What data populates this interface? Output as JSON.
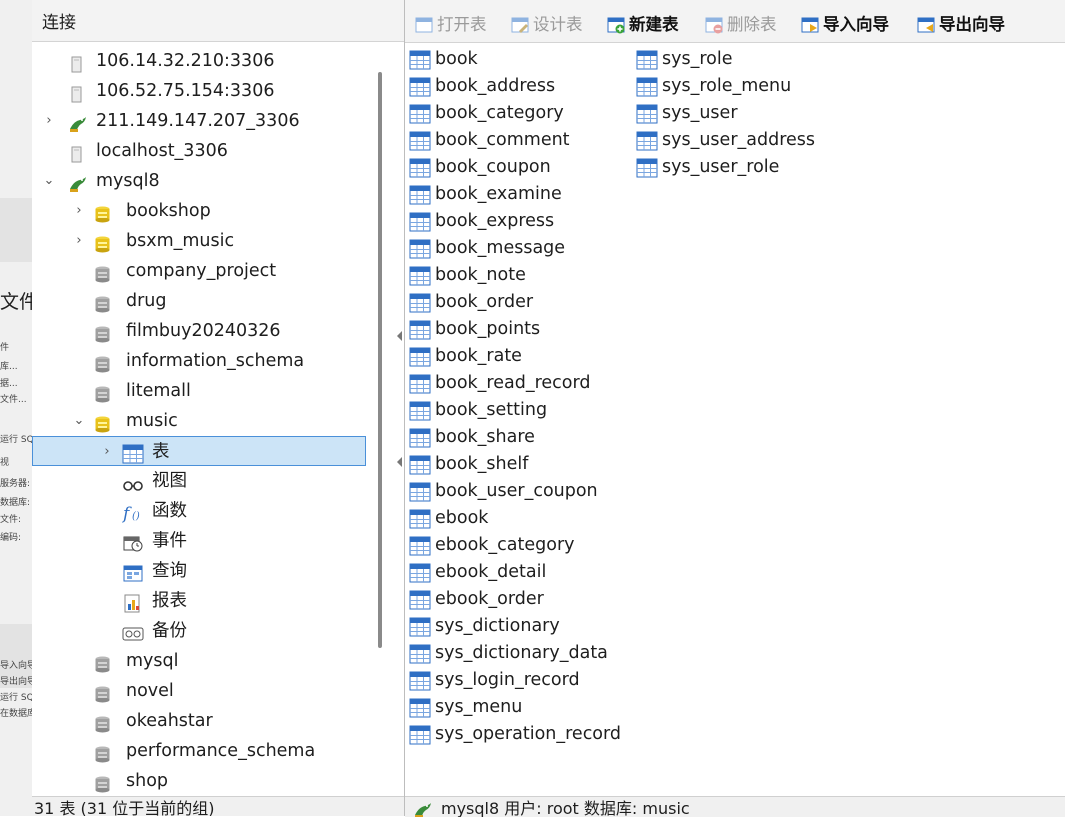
{
  "connections_panel": {
    "title": "连接",
    "status": "31 表 (31 位于当前的组)"
  },
  "tree": [
    {
      "label": "106.14.32.210:3306",
      "icon": "server-file-icon",
      "chevron": "",
      "level": 0
    },
    {
      "label": "106.52.75.154:3306",
      "icon": "server-file-icon",
      "chevron": "",
      "level": 0
    },
    {
      "label": "211.149.147.207_3306",
      "icon": "connection-dolphin-icon",
      "chevron": "›",
      "level": 0
    },
    {
      "label": "localhost_3306",
      "icon": "server-file-icon",
      "chevron": "",
      "level": 0
    },
    {
      "label": "mysql8",
      "icon": "connection-dolphin-icon",
      "chevron": "⌄",
      "level": 0
    },
    {
      "label": "bookshop",
      "icon": "database-open-icon",
      "chevron": "›",
      "level": 1
    },
    {
      "label": "bsxm_music",
      "icon": "database-open-icon",
      "chevron": "›",
      "level": 1
    },
    {
      "label": "company_project",
      "icon": "database-closed-icon",
      "chevron": "",
      "level": 1
    },
    {
      "label": "drug",
      "icon": "database-closed-icon",
      "chevron": "",
      "level": 1
    },
    {
      "label": "filmbuy20240326",
      "icon": "database-closed-icon",
      "chevron": "",
      "level": 1
    },
    {
      "label": "information_schema",
      "icon": "database-closed-icon",
      "chevron": "",
      "level": 1
    },
    {
      "label": "litemall",
      "icon": "database-closed-icon",
      "chevron": "",
      "level": 1
    },
    {
      "label": "music",
      "icon": "database-open-icon",
      "chevron": "⌄",
      "level": 1
    },
    {
      "label": "表",
      "icon": "tables-node-icon",
      "chevron": "›",
      "level": 2,
      "selected": true
    },
    {
      "label": "视图",
      "icon": "views-node-icon",
      "chevron": "",
      "level": 2
    },
    {
      "label": "函数",
      "icon": "functions-node-icon",
      "chevron": "",
      "level": 2
    },
    {
      "label": "事件",
      "icon": "events-node-icon",
      "chevron": "",
      "level": 2
    },
    {
      "label": "查询",
      "icon": "queries-node-icon",
      "chevron": "",
      "level": 2
    },
    {
      "label": "报表",
      "icon": "reports-node-icon",
      "chevron": "",
      "level": 2
    },
    {
      "label": "备份",
      "icon": "backups-node-icon",
      "chevron": "",
      "level": 2
    },
    {
      "label": "mysql",
      "icon": "database-closed-icon",
      "chevron": "",
      "level": 1
    },
    {
      "label": "novel",
      "icon": "database-closed-icon",
      "chevron": "",
      "level": 1
    },
    {
      "label": "okeahstar",
      "icon": "database-closed-icon",
      "chevron": "",
      "level": 1
    },
    {
      "label": "performance_schema",
      "icon": "database-closed-icon",
      "chevron": "",
      "level": 1
    },
    {
      "label": "shop",
      "icon": "database-closed-icon",
      "chevron": "",
      "level": 1
    }
  ],
  "toolbar": [
    {
      "label": "打开表",
      "name": "open-table-button",
      "icon": "open-table-icon",
      "enabled": false
    },
    {
      "label": "设计表",
      "name": "design-table-button",
      "icon": "design-table-icon",
      "enabled": false
    },
    {
      "label": "新建表",
      "name": "new-table-button",
      "icon": "new-table-icon",
      "enabled": true
    },
    {
      "label": "删除表",
      "name": "delete-table-button",
      "icon": "delete-table-icon",
      "enabled": false
    },
    {
      "label": "导入向导",
      "name": "import-wizard-button",
      "icon": "import-wizard-icon",
      "enabled": true
    },
    {
      "label": "导出向导",
      "name": "export-wizard-button",
      "icon": "export-wizard-icon",
      "enabled": true
    }
  ],
  "tables_col1": [
    "book",
    "book_address",
    "book_category",
    "book_comment",
    "book_coupon",
    "book_examine",
    "book_express",
    "book_message",
    "book_note",
    "book_order",
    "book_points",
    "book_rate",
    "book_read_record",
    "book_setting",
    "book_share",
    "book_shelf",
    "book_user_coupon",
    "ebook",
    "ebook_category",
    "ebook_detail",
    "ebook_order",
    "sys_dictionary",
    "sys_dictionary_data",
    "sys_login_record",
    "sys_menu",
    "sys_operation_record"
  ],
  "tables_col2": [
    "sys_role",
    "sys_role_menu",
    "sys_user",
    "sys_user_address",
    "sys_user_role"
  ],
  "status_bar": {
    "text": "mysql8   用户: root   数据库: music"
  },
  "background_fragments": {
    "big_text": "文件",
    "lines": [
      "件",
      "库...",
      "据...",
      "文件...",
      "",
      "运行 SQL",
      "视",
      "服务器:",
      "数据库:",
      "文件:",
      "编码:",
      "",
      "",
      "导入向导",
      "导出向导",
      "运行 SQL",
      "在数据库"
    ]
  },
  "colors": {
    "selection_bg": "#cce4f7",
    "selection_border": "#4a90d9",
    "table_icon_blue": "#2f6fc4",
    "db_yellow": "#e8c21a",
    "db_gray": "#9a9a9a"
  }
}
